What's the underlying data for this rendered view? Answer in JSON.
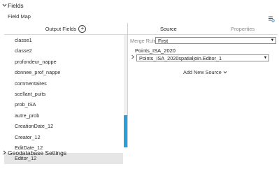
{
  "fields_section": {
    "chevron": "chevron-down-icon",
    "title": "Fields"
  },
  "field_map_label": "Field Map",
  "output_fields": {
    "header": "Output Fields",
    "add_icon": "plus-circle-icon",
    "items": [
      "classe1",
      "classe2",
      "profondeur_nappe",
      "donnee_prof_nappe",
      "commentaires",
      "scellant_puits",
      "prob_ISA",
      "autre_prob",
      "CreationDate_12",
      "Creator_12",
      "EditDate_12",
      "Editor_12"
    ],
    "selected": "Editor_12"
  },
  "tabs": {
    "source": "Source",
    "properties": "Properties"
  },
  "merge_rule": {
    "label": "Merge Rule",
    "value": "First"
  },
  "source": {
    "title": "Points_ISA_2020",
    "field_value": "Points_ISA_2020spatialjoin.Editor_1",
    "add_new": "Add New Source"
  },
  "geodatabase_section": {
    "chevron": "chevron-right-icon",
    "title": "Geodatabase Settings"
  },
  "colors": {
    "scroll_thumb": "#2a9fd8",
    "selected_row": "#e6e6e6"
  }
}
